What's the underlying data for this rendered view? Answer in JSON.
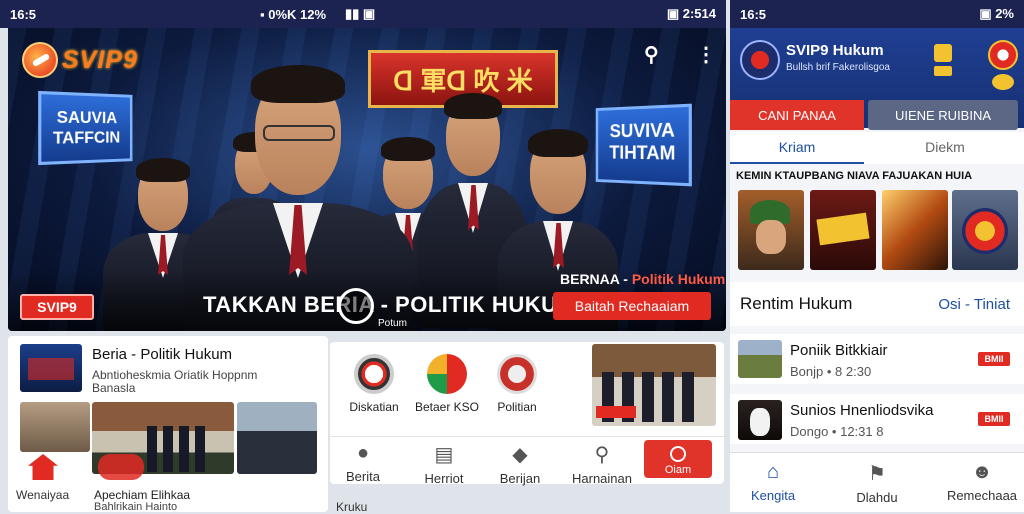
{
  "status_left": {
    "time": "16:5",
    "icons": "▪ 0%K 12%",
    "signal": "▮▮ ▣",
    "right": "▣ 2:514",
    "time2": "16:5"
  },
  "status_right": {
    "time": "16:5",
    "right": "▣ 2%"
  },
  "hero": {
    "logo_text": "SVIP9",
    "ribbon_text": "ᗡ 軍ᗡ 吹 米",
    "left_sign": "SAUVIA\nTAFFCIN",
    "right_sign": "SUVIVA\nTIHTAM",
    "title": "TAKKAN BERIA - POLITIK HUKUM",
    "subtitle_prefix": "BERNAA - ",
    "subtitle_accent": "Politik Hukum",
    "badge": "SVIP9",
    "cta": "Baitah Rechaaiam",
    "center_caption": "Potum"
  },
  "card_news": {
    "title": "Beria - Politik Hukum",
    "desc": "Abntioheskmia Oriatik Hoppnm",
    "desc2": "Banasla"
  },
  "left_bottom": {
    "home_label": "Wenaiyaa",
    "caption1": "Apechiam Elihkaa",
    "caption2": "Bahlrikain Hainto"
  },
  "mid_icons": [
    {
      "label": "Diskatian"
    },
    {
      "label": "Betaer KSO"
    },
    {
      "label": "Politian"
    }
  ],
  "mid_nav": [
    {
      "label": "Berita"
    },
    {
      "label": "Herriot"
    },
    {
      "label": "Berijan"
    },
    {
      "label": "Harnainan"
    },
    {
      "label": "Oiam"
    }
  ],
  "bottom_strip": "Kruku",
  "right": {
    "app_title": "SVIP9 Hukum",
    "app_sub": "Bullsh brif Fakerolisgoa",
    "btn_red": "CANI PANAA",
    "btn_grey": "UIENE RUIBINA",
    "tab_active": "Kriam",
    "tab_inactive": "Diekm",
    "headline": "KEMIN KTAUPBANG NIAVA FAJUAKAN HUIA",
    "section_title": "Rentim Hukum",
    "section_link": "Osi - Tiniat",
    "news": [
      {
        "title": "Poniik Bitkkiair",
        "meta": "Bonjp • 8 2:30",
        "tag": "BMII"
      },
      {
        "title": "Sunios Hnenliodsvika",
        "meta": "Dongo • 12:31  8",
        "tag": "BMII"
      }
    ],
    "nav": [
      {
        "label": "Kengita"
      },
      {
        "label": "Dlahdu"
      },
      {
        "label": "Remechaaa"
      }
    ]
  },
  "colors": {
    "navy": "#1c2350",
    "accent_red": "#e02a22",
    "blue": "#1f4fa0"
  }
}
